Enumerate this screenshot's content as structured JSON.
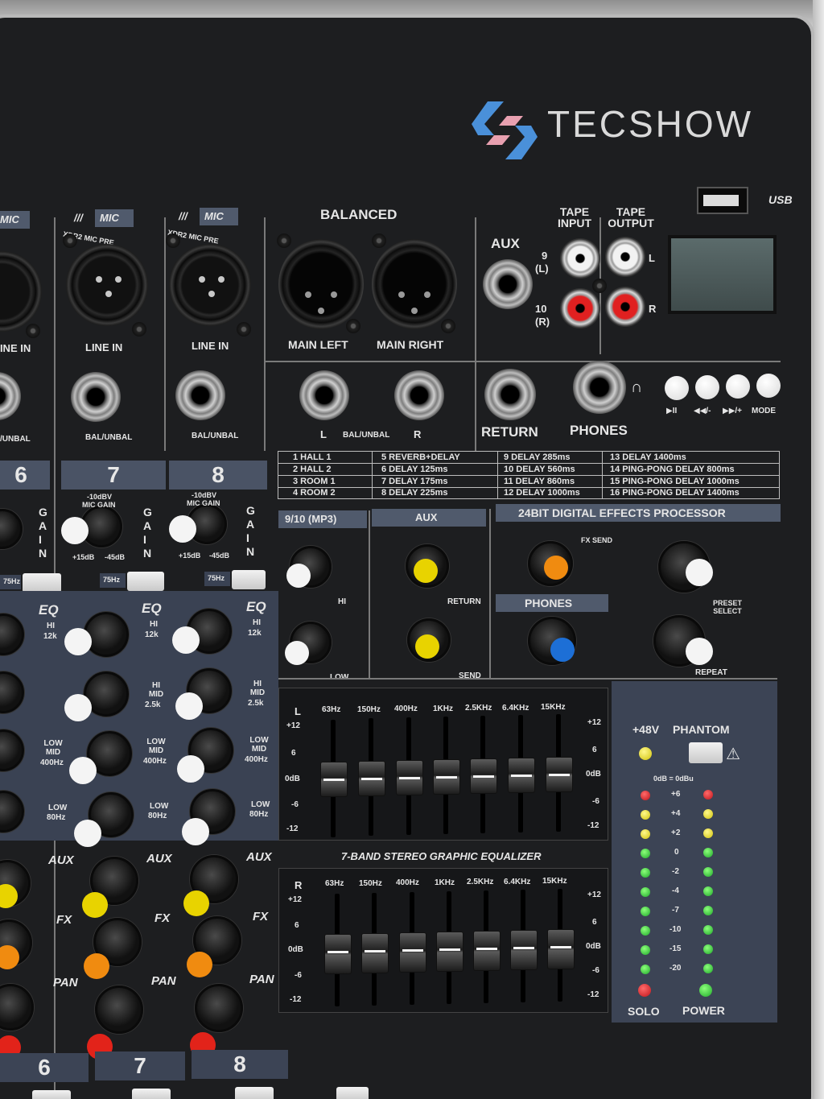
{
  "brand": {
    "name": "TECSHOW",
    "usb_label": "USB"
  },
  "channels": [
    {
      "number": "6",
      "mic_label": "MIC",
      "line_in": "LINE IN",
      "balance": "/UNBAL"
    },
    {
      "number": "7",
      "mic_label": "MIC",
      "preamp": "XDR2 MIC PRE",
      "line_in": "LINE IN",
      "balance": "BAL/UNBAL",
      "gain": "GAIN",
      "gain_min": "+15dB",
      "gain_max": "-45dB",
      "ref": "-10dBV",
      "mic_gain": "MIC GAIN",
      "hpf": "75Hz"
    },
    {
      "number": "8",
      "mic_label": "MIC",
      "preamp": "XDR2 MIC PRE",
      "line_in": "LINE IN",
      "balance": "BAL/UNBAL",
      "gain": "GAIN",
      "gain_min": "+15dB",
      "gain_max": "-45dB",
      "ref": "-10dBV",
      "mic_gain": "MIC GAIN",
      "hpf": "75Hz"
    }
  ],
  "eq": {
    "title": "EQ",
    "hi": "HI",
    "hi_freq": "12k",
    "himid": "HI MID",
    "himid_freq": "2.5k",
    "lowmid": "LOW MID",
    "lowmid_freq": "400Hz",
    "low": "LOW",
    "low_freq": "80Hz",
    "aux": "AUX",
    "fx": "FX",
    "pan": "PAN"
  },
  "io": {
    "balanced": "BALANCED",
    "main_left": "MAIN LEFT",
    "main_right": "MAIN RIGHT",
    "left": "L",
    "bal_unbal": "BAL/UNBAL",
    "right": "R",
    "aux": "AUX",
    "return": "RETURN",
    "phones": "PHONES",
    "tape_input": "TAPE INPUT",
    "tape_output": "TAPE OUTPUT",
    "ch9": "9",
    "ch9_side": "(L)",
    "ch10": "10",
    "ch10_side": "(R)",
    "tape_l": "L",
    "tape_r": "R"
  },
  "player_buttons": {
    "play": "▶II",
    "prev": "◀◀/-",
    "next": "▶▶/+",
    "mode": "MODE"
  },
  "effects_table": [
    [
      "1  HALL 1",
      "5  REVERB+DELAY",
      "9  DELAY 285ms",
      "13  DELAY 1400ms"
    ],
    [
      "2  HALL 2",
      "6  DELAY 125ms",
      "10  DELAY 560ms",
      "14  PING-PONG DELAY 800ms"
    ],
    [
      "3  ROOM 1",
      "7  DELAY 175ms",
      "11  DELAY 860ms",
      "15  PING-PONG DELAY 1000ms"
    ],
    [
      "4  ROOM 2",
      "8  DELAY 225ms",
      "12  DELAY 1000ms",
      "16  PING-PONG DELAY 1400ms"
    ]
  ],
  "sections": {
    "mp3": "9/10 (MP3)",
    "hi": "HI",
    "low": "LOW",
    "aux": "AUX",
    "aux_return": "RETURN",
    "aux_send": "SEND",
    "dsp": "24BIT DIGITAL EFFECTS PROCESSOR",
    "fx_send": "FX SEND",
    "phones": "PHONES",
    "preset_select": "PRESET SELECT",
    "repeat": "REPEAT"
  },
  "graphic_eq": {
    "title": "7-BAND STEREO GRAPHIC EQUALIZER",
    "bands": [
      "63Hz",
      "150Hz",
      "400Hz",
      "1KHz",
      "2.5KHz",
      "6.4KHz",
      "15KHz"
    ],
    "scale": [
      "+12",
      "6",
      "0dB",
      "-6",
      "-12"
    ],
    "left_label": "L",
    "right_label": "R"
  },
  "meter": {
    "phantom_voltage": "+48V",
    "phantom": "PHANTOM",
    "reference": "0dB = 0dBu",
    "scale": [
      "+6",
      "+4",
      "+2",
      "0",
      "-2",
      "-4",
      "-7",
      "-10",
      "-15",
      "-20"
    ],
    "solo": "SOLO",
    "power": "POWER"
  }
}
